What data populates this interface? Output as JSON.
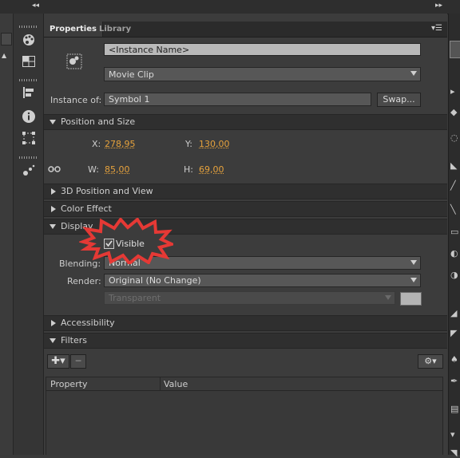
{
  "tabs": {
    "properties": "Properties",
    "library": "Library"
  },
  "instance_name_placeholder": "<Instance Name>",
  "symbol_type": "Movie Clip",
  "instance_of": {
    "label": "Instance of:",
    "value": "Symbol 1",
    "swap_label": "Swap..."
  },
  "sections": {
    "position_size": "Position and Size",
    "position_3d": "3D Position and View",
    "color_effect": "Color Effect",
    "display": "Display",
    "accessibility": "Accessibility",
    "filters": "Filters"
  },
  "position": {
    "x_label": "X:",
    "x_value": "278,95",
    "y_label": "Y:",
    "y_value": "130,00",
    "w_label": "W:",
    "w_value": "85,00",
    "h_label": "H:",
    "h_value": "69,00"
  },
  "display": {
    "visible_label": "Visible",
    "visible_checked": true,
    "blending_label": "Blending:",
    "blending_value": "Normal",
    "render_label": "Render:",
    "render_value": "Original (No Change)",
    "background_value": "Transparent"
  },
  "filters_table": {
    "col_property": "Property",
    "col_value": "Value"
  },
  "colors": {
    "accent_number": "#e6a23c",
    "annotation_red": "#e53935"
  }
}
